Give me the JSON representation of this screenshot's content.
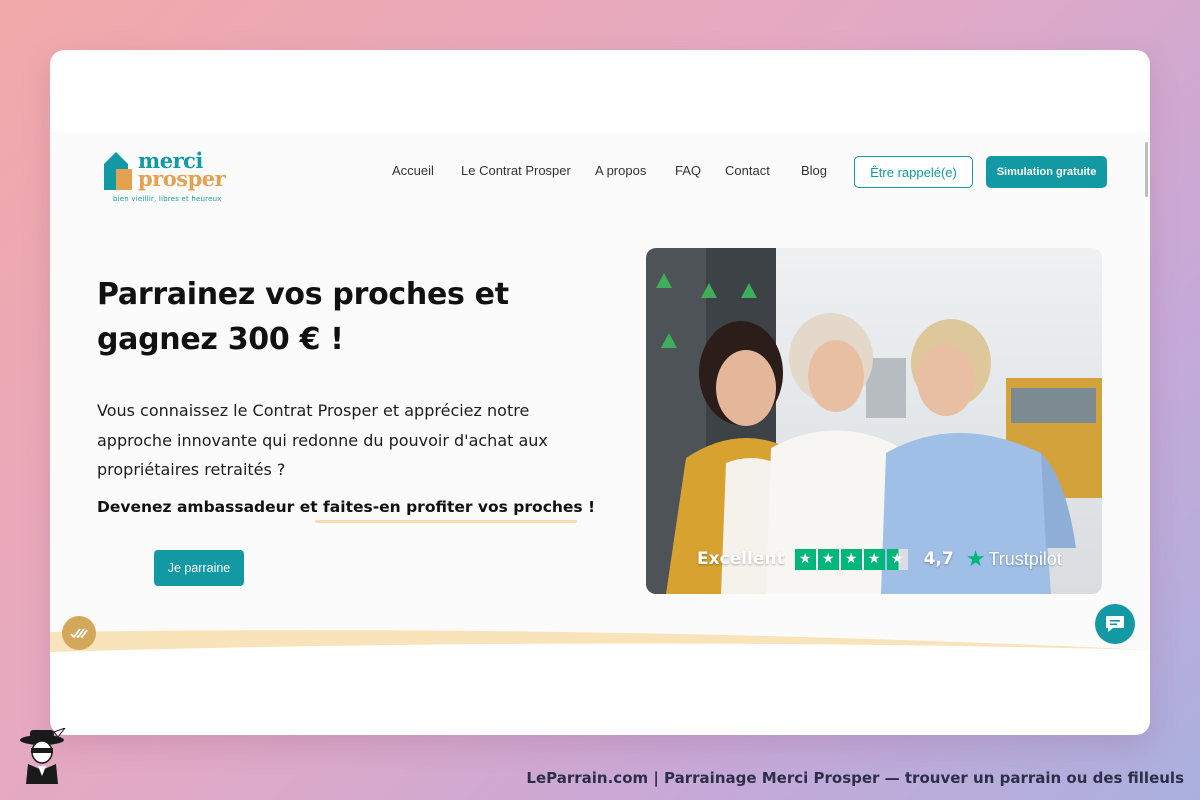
{
  "brand": {
    "word1": "merci",
    "word2": "prosper",
    "tagline": "bien vieillir, libres et heureux",
    "colors": {
      "teal": "#1299a3",
      "gold": "#e3a24f"
    }
  },
  "nav": {
    "items": [
      {
        "label": "Accueil"
      },
      {
        "label": "Le Contrat Prosper"
      },
      {
        "label": "A propos"
      },
      {
        "label": "FAQ"
      },
      {
        "label": "Contact"
      },
      {
        "label": "Blog"
      }
    ],
    "callback_button": "Être rappelé(e)",
    "simulation_button": "Simulation gratuite"
  },
  "hero": {
    "title": "Parrainez vos proches et gagnez 300 € !",
    "text": "Vous connaissez le Contrat Prosper et appréciez notre approche innovante qui redonne du pouvoir d'achat aux propriétaires retraités ?",
    "strong_part1": "Devenez ambassadeur et ",
    "strong_part2": "faites-en profiter vos proches !",
    "cta": "Je parraine"
  },
  "trustpilot": {
    "label": "Excellent",
    "score": "4,7",
    "stars": 4.7,
    "brand": "Trustpilot"
  },
  "icons": {
    "left_badge": "check-ticks-icon",
    "chat": "chat-bubble-icon",
    "mascot": "mascot-icon"
  },
  "footer": {
    "caption": "LeParrain.com | Parrainage Merci Prosper — trouver un parrain ou des filleuls"
  }
}
